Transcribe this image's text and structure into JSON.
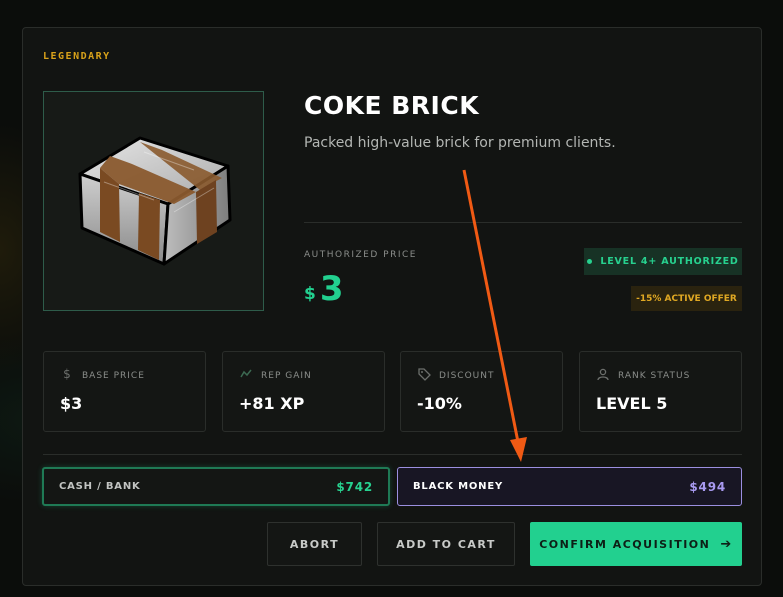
{
  "item": {
    "rarity": "LEGENDARY",
    "name": "COKE BRICK",
    "description": "Packed high-value brick for premium clients.",
    "image_icon": "coke-brick-icon"
  },
  "price": {
    "label": "AUTHORIZED PRICE",
    "currency": "$",
    "amount": "3"
  },
  "badges": {
    "authorized": "LEVEL 4+ AUTHORIZED",
    "offer": "-15% ACTIVE OFFER"
  },
  "stats": [
    {
      "icon": "dollar-icon",
      "label": "BASE PRICE",
      "value": "$3"
    },
    {
      "icon": "rep-icon",
      "label": "REP GAIN",
      "value": "+81 XP"
    },
    {
      "icon": "tag-icon",
      "label": "DISCOUNT",
      "value": "-10%"
    },
    {
      "icon": "user-icon",
      "label": "RANK STATUS",
      "value": "LEVEL 5"
    }
  ],
  "payment": {
    "cash": {
      "label": "CASH / BANK",
      "amount": "$742"
    },
    "black": {
      "label": "BLACK MONEY",
      "amount": "$494"
    }
  },
  "actions": {
    "abort": "ABORT",
    "add_to_cart": "ADD TO CART",
    "confirm": "CONFIRM ACQUISITION",
    "confirm_icon": "arrow-right-icon"
  },
  "colors": {
    "accent": "#22d08f",
    "rarity": "#d9a21a",
    "black_money": "#a89af0",
    "annotation_arrow": "#f05a14"
  }
}
